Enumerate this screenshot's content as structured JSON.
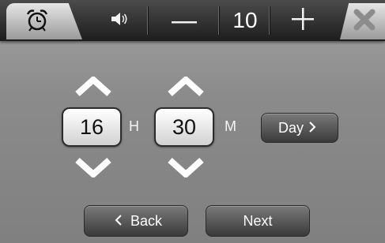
{
  "topbar": {
    "volume_value": "10",
    "minus_symbol": "—",
    "plus_symbol": "+"
  },
  "time": {
    "hour": "16",
    "hour_unit": "H",
    "minute": "30",
    "minute_unit": "M"
  },
  "buttons": {
    "day_label": "Day",
    "back_label": "Back",
    "next_label": "Next"
  },
  "icons": {
    "alarm": "alarm-clock-icon",
    "speaker": "speaker-icon",
    "close": "close-icon"
  }
}
